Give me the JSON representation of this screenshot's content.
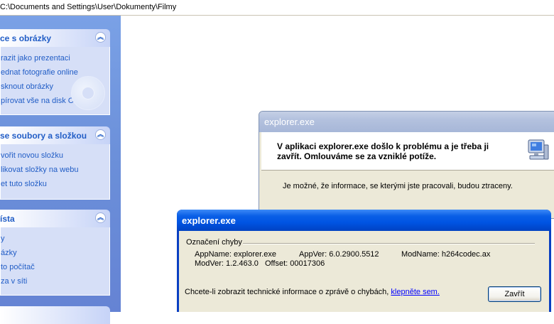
{
  "address": {
    "path": "C:\\Documents and Settings\\User\\Dokumenty\\Filmy"
  },
  "taskpane": {
    "panels": [
      {
        "title": "ce s obrázky",
        "links": [
          "razit jako prezentaci",
          "ednat fotografie online",
          "sknout obrázky",
          "pírovat vše na disk CD"
        ]
      },
      {
        "title": "se soubory a složkou",
        "links": [
          "vořit novou složku",
          "likovat složky na webu",
          "et tuto složku"
        ]
      },
      {
        "title": "ísta",
        "links": [
          "y",
          "ázky",
          "to počítač",
          "za v síti"
        ]
      }
    ],
    "chevron_up": "︽"
  },
  "dialog_main": {
    "title": "explorer.exe",
    "message": "V aplikaci explorer.exe došlo k problému a je třeba ji zavřít. Omlouváme se za vzniklé potíže.",
    "info": "Je možné, že informace, se kterými jste pracovali, budou ztraceny.",
    "icon": "computer-icon"
  },
  "dialog_signature": {
    "title": "explorer.exe",
    "group_label": "Označení chyby",
    "row1": {
      "appname": "AppName: explorer.exe",
      "appver": "AppVer: 6.0.2900.5512",
      "modname": "ModName: h264codec.ax"
    },
    "row2": {
      "modver": "ModVer: 1.2.463.0",
      "offset": "Offset: 00017306"
    },
    "details_text": "Chcete-li zobrazit technické informace o zprávě o chybách, ",
    "details_link": "klepněte sem.",
    "close_button": "Zavřít"
  }
}
